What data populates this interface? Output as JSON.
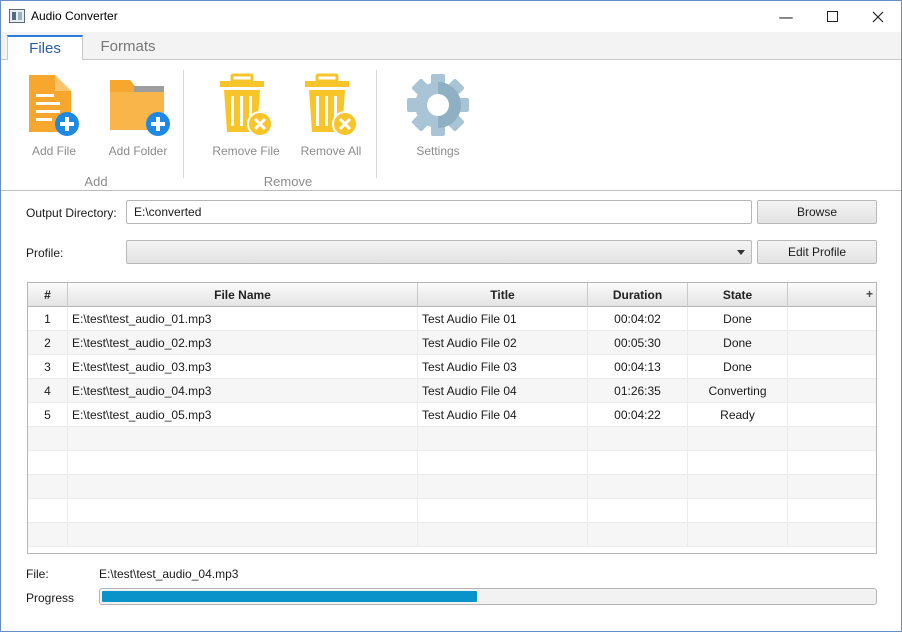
{
  "window": {
    "title": "Audio Converter"
  },
  "tabs": [
    {
      "label": "Files",
      "active": true
    },
    {
      "label": "Formats",
      "active": false
    }
  ],
  "ribbon": {
    "groups": [
      {
        "label": "Add",
        "buttons": [
          {
            "label": "Add File",
            "icon": "add-file-icon"
          },
          {
            "label": "Add Folder",
            "icon": "add-folder-icon"
          }
        ]
      },
      {
        "label": "Remove",
        "buttons": [
          {
            "label": "Remove File",
            "icon": "remove-file-icon"
          },
          {
            "label": "Remove All",
            "icon": "remove-all-icon"
          }
        ]
      },
      {
        "label": "",
        "buttons": [
          {
            "label": "Settings",
            "icon": "gear-icon"
          }
        ]
      }
    ]
  },
  "output": {
    "label": "Output Directory:",
    "value": "E:\\converted",
    "browse_label": "Browse"
  },
  "profile": {
    "label": "Profile:",
    "value": "",
    "edit_label": "Edit Profile"
  },
  "table": {
    "columns": [
      "#",
      "File Name",
      "Title",
      "Duration",
      "State"
    ],
    "add_column_glyph": "+",
    "rows": [
      {
        "num": "1",
        "file": "E:\\test\\test_audio_01.mp3",
        "title": "Test Audio File 01",
        "duration": "00:04:02",
        "state": "Done"
      },
      {
        "num": "2",
        "file": "E:\\test\\test_audio_02.mp3",
        "title": "Test Audio File 02",
        "duration": "00:05:30",
        "state": "Done"
      },
      {
        "num": "3",
        "file": "E:\\test\\test_audio_03.mp3",
        "title": "Test Audio File 03",
        "duration": "00:04:13",
        "state": "Done"
      },
      {
        "num": "4",
        "file": "E:\\test\\test_audio_04.mp3",
        "title": "Test Audio File 04",
        "duration": "01:26:35",
        "state": "Converting"
      },
      {
        "num": "5",
        "file": "E:\\test\\test_audio_05.mp3",
        "title": "Test Audio File 04",
        "duration": "00:04:22",
        "state": "Ready"
      }
    ]
  },
  "status": {
    "file_label": "File:",
    "file_value": "E:\\test\\test_audio_04.mp3",
    "progress_label": "Progress",
    "progress_fraction": 0.486
  },
  "colors": {
    "accent": "#2a7ad6",
    "progress": "#0a93c9",
    "icon_orange": "#f7a62e",
    "icon_yellow": "#f7c52a",
    "icon_blue": "#1e88e5",
    "gear": "#a9c4d4"
  }
}
